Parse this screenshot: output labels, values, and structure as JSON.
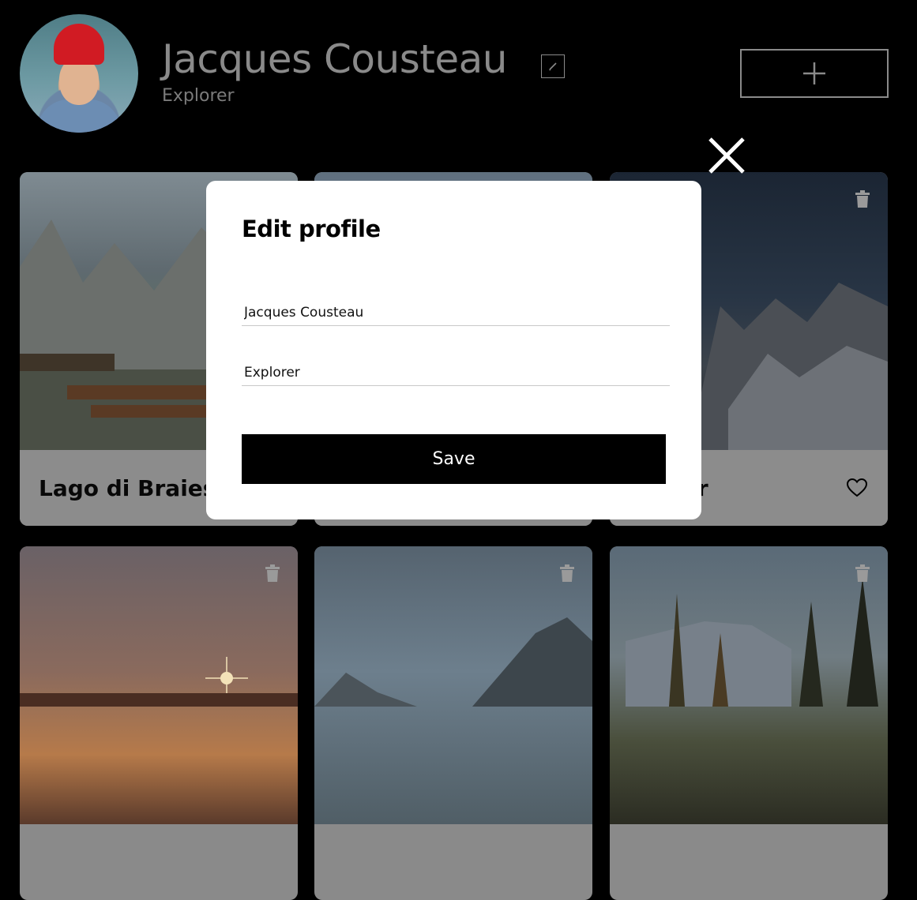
{
  "profile": {
    "name": "Jacques Cousteau",
    "description": "Explorer"
  },
  "cards": [
    {
      "title": "Lago di Braies"
    },
    {
      "title": ""
    },
    {
      "title": "ar"
    },
    {
      "title": ""
    },
    {
      "title": ""
    },
    {
      "title": ""
    }
  ],
  "modal": {
    "title": "Edit profile",
    "name_value": "Jacques Cousteau",
    "about_value": "Explorer",
    "save_label": "Save"
  },
  "icons": {
    "edit": "pencil-icon",
    "add": "plus-icon",
    "close": "close-icon",
    "trash": "trash-icon",
    "like": "heart-icon"
  },
  "colors": {
    "page_background": "#000000",
    "overlay_text": "#8a8a8a",
    "modal_background": "#ffffff",
    "button_background": "#000000",
    "button_text": "#ffffff"
  }
}
